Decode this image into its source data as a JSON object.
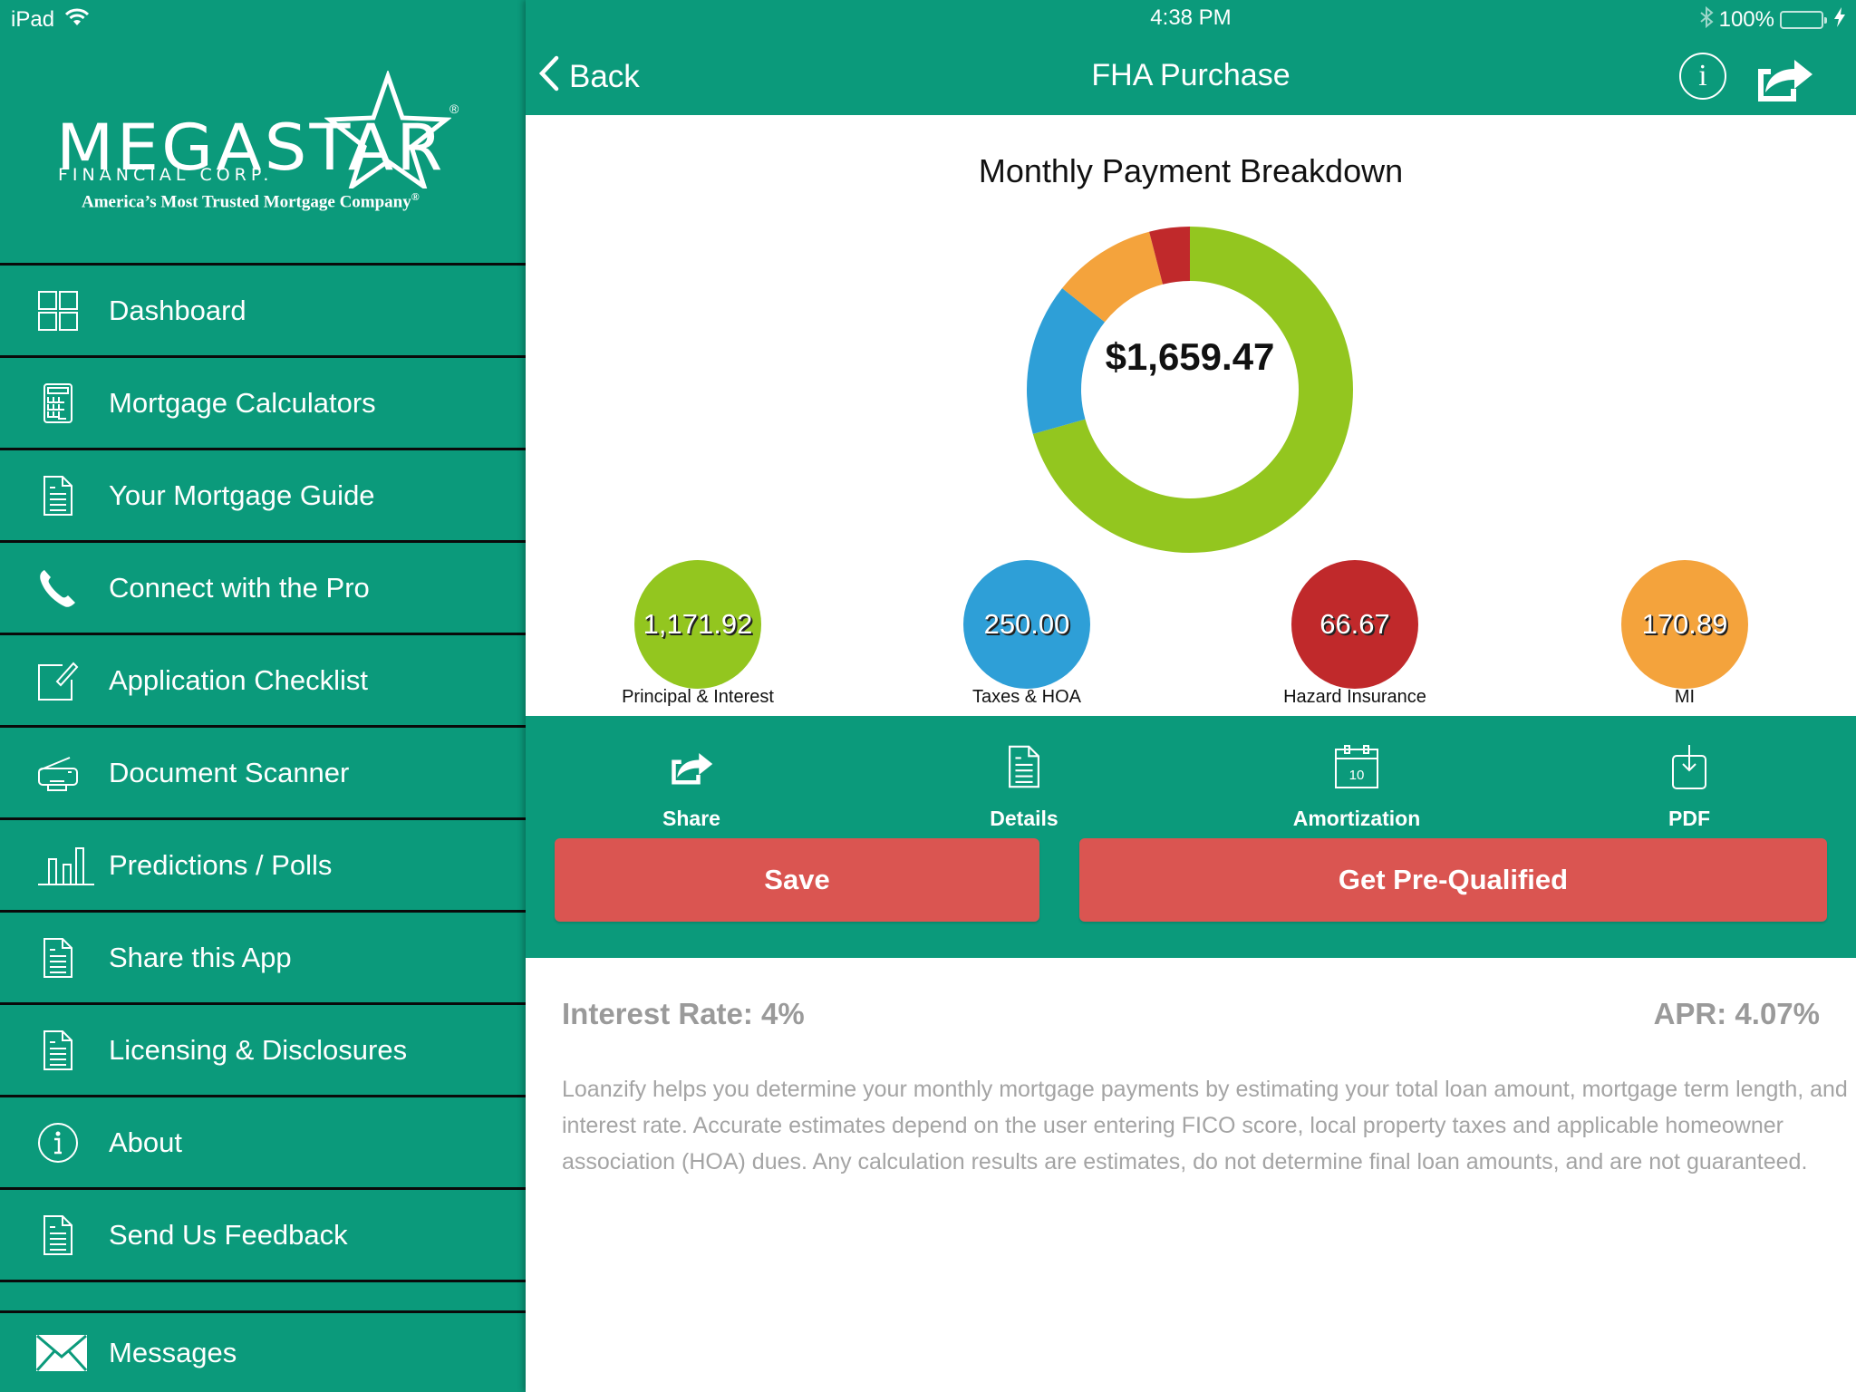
{
  "status_bar": {
    "device": "iPad",
    "time": "4:38 PM",
    "battery": "100%",
    "battery_level": 1.0
  },
  "brand": {
    "name": "MEGASTAR",
    "subtitle": "FINANCIAL CORP.",
    "tagline": "America’s Most Trusted Mortgage Company",
    "registered": "®"
  },
  "sidebar": {
    "items": [
      {
        "label": "Dashboard",
        "icon": "dashboard-grid-icon"
      },
      {
        "label": "Mortgage Calculators",
        "icon": "calculator-icon"
      },
      {
        "label": "Your Mortgage Guide",
        "icon": "document-icon"
      },
      {
        "label": "Connect with the Pro",
        "icon": "phone-icon"
      },
      {
        "label": "Application Checklist",
        "icon": "edit-checklist-icon"
      },
      {
        "label": "Document Scanner",
        "icon": "scanner-icon"
      },
      {
        "label": "Predictions / Polls",
        "icon": "bar-chart-icon"
      },
      {
        "label": "Share this App",
        "icon": "document-icon"
      },
      {
        "label": "Licensing & Disclosures",
        "icon": "document-icon"
      },
      {
        "label": "About",
        "icon": "info-icon"
      },
      {
        "label": "Send Us Feedback",
        "icon": "document-icon"
      }
    ],
    "messages_label": "Messages"
  },
  "navbar": {
    "back_label": "Back",
    "title": "FHA Purchase",
    "info_glyph": "i"
  },
  "chart_data": {
    "type": "pie",
    "title": "Monthly Payment Breakdown",
    "center_label": "$1,659.47",
    "total": 1659.47,
    "slices": [
      {
        "name": "Principal & Interest",
        "value": 1171.92,
        "display": "1,171.92",
        "color": "#93c61f"
      },
      {
        "name": "Taxes & HOA",
        "value": 250.0,
        "display": "250.00",
        "color": "#2e9fd7"
      },
      {
        "name": "MI",
        "value": 170.89,
        "display": "170.89",
        "color": "#f4a33c"
      },
      {
        "name": "Hazard Insurance",
        "value": 66.67,
        "display": "66.67",
        "color": "#c0292b"
      }
    ],
    "legend_order": [
      "Principal & Interest",
      "Taxes & HOA",
      "Hazard Insurance",
      "MI"
    ],
    "start": "top",
    "direction": "clockwise-from-top: P&I, then counterclockwise Taxes, MI, Hazard"
  },
  "actions": [
    {
      "label": "Share",
      "icon": "share-icon"
    },
    {
      "label": "Details",
      "icon": "document-icon"
    },
    {
      "label": "Amortization",
      "icon": "calendar-icon",
      "calendar_day": "10"
    },
    {
      "label": "PDF",
      "icon": "download-icon"
    }
  ],
  "buttons": {
    "save": "Save",
    "prequalify": "Get Pre-Qualified"
  },
  "rates": {
    "interest_rate": "Interest Rate: 4%",
    "apr": "APR: 4.07%"
  },
  "disclaimer": "Loanzify helps you determine your monthly mortgage payments by estimating your total loan amount, mortgage term length, and interest rate. Accurate estimates depend on the user entering FICO score, local property taxes and applicable homeowner association (HOA) dues. Any calculation results are estimates, do not determine final loan amounts, and are not guaranteed.",
  "colors": {
    "brand_green": "#0b9a7b",
    "button_red": "#da5551"
  }
}
